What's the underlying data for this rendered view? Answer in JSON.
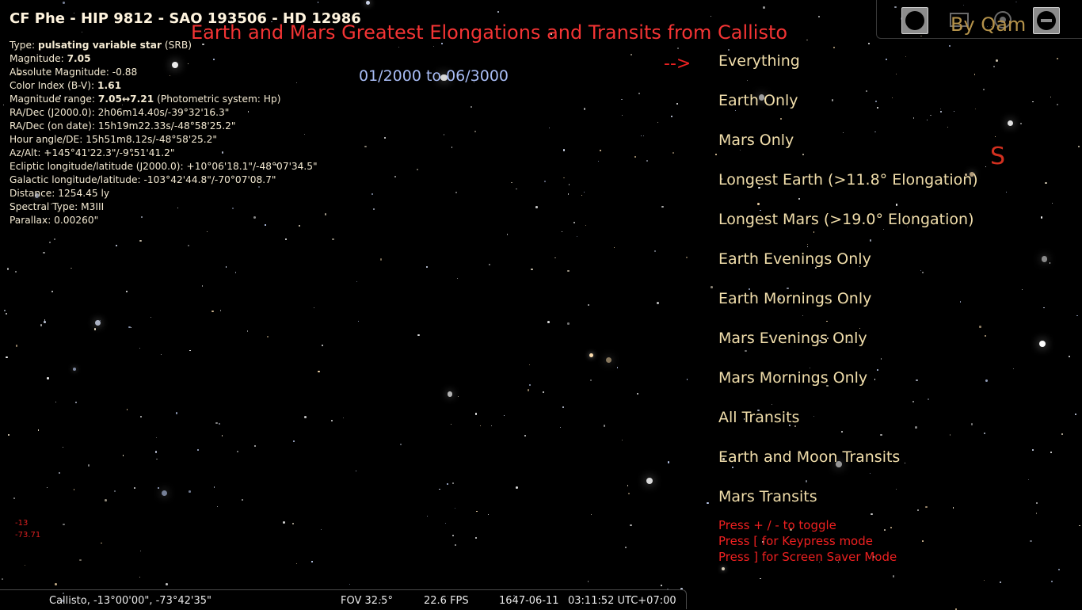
{
  "object": {
    "title": "CF Phe - HIP 9812 - SAO 193506 - HD 12986",
    "type_label": "Type: ",
    "type_value": "pulsating variable star",
    "type_suffix": " (SRB)",
    "magnitude_label": "Magnitude: ",
    "magnitude_value": "7.05",
    "absolute_magnitude": "Absolute Magnitude: -0.88",
    "color_index_label": "Color Index (B-V): ",
    "color_index_value": "1.61",
    "magnitude_range_label": "Magnitude range: ",
    "magnitude_range_value": "7.05↔7.21",
    "magnitude_range_suffix": " (Photometric system: Hp)",
    "ra_dec_j2000": "RA/Dec (J2000.0): 2h06m14.40s/-39°32'16.3\"",
    "ra_dec_date": "RA/Dec (on date): 15h19m22.33s/-48°58'25.2\"",
    "hour_angle": "Hour angle/DE: 15h51m8.12s/-48°58'25.2\"",
    "az_alt": "Az/Alt: +145°41'22.3\"/-9°51'41.2\"",
    "ecliptic": "Ecliptic longitude/latitude (J2000.0): +10°06'18.1\"/-48°07'34.5\"",
    "galactic": "Galactic longitude/latitude: -103°42'44.8\"/-70°07'08.7\"",
    "distance": "Distance: 1254.45 ly",
    "spectral": "Spectral Type: M3III",
    "parallax": "Parallax: 0.00260\""
  },
  "script": {
    "title": "Earth and Mars Greatest Elongations and Transits from Callisto",
    "date_range": "01/2000 to 06/3000",
    "arrow": "-->",
    "menu": [
      "Everything",
      "Earth Only",
      "Mars Only",
      "Longest Earth (>11.8° Elongation)",
      "Longest Mars (>19.0° Elongation)",
      "Earth Evenings Only",
      "Earth Mornings Only",
      "Mars Evenings Only",
      "Mars Mornings Only",
      "All Transits",
      "Earth and Moon Transits",
      "Mars Transits"
    ],
    "hints": [
      "Press + / - to toggle",
      "Press [ for Keypress mode",
      "Press ] for Screen Saver Mode"
    ],
    "byline": "By Qam"
  },
  "cardinal": "S",
  "coords": {
    "lat": "-13",
    "lon": "-73.71"
  },
  "toolbar": {
    "icons": [
      "window-icon",
      "screen-icon",
      "settings-icon",
      "quit-icon"
    ]
  },
  "status": {
    "location": "Callisto, -13°00'00\", -73°42'35\"",
    "fov": "FOV 32.5°",
    "fps": "22.6 FPS",
    "date": "1647-06-11",
    "time": "03:11:52 UTC+07:00"
  },
  "colors": {
    "title_red": "#f33434",
    "menu_text": "#f1deab",
    "date_blue": "#a9bdf6",
    "byline_gold": "#b4924a"
  }
}
